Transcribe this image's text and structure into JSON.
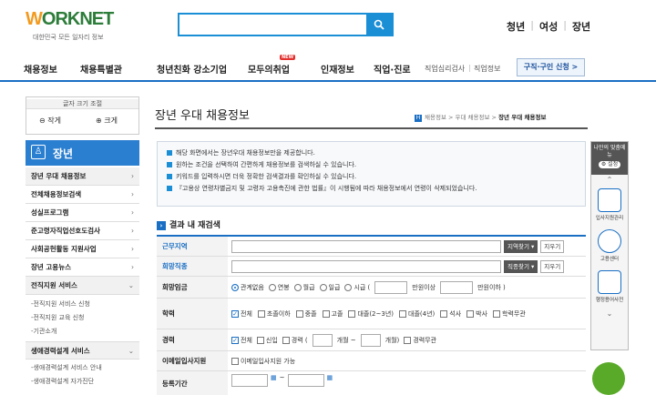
{
  "header": {
    "logo_text_w": "W",
    "logo_text_rest": "ORKNET",
    "logo_sub": "대한민국 모든 일자리 정보",
    "search_placeholder": "",
    "top_links": [
      "청년",
      "여성",
      "장년"
    ]
  },
  "nav": {
    "items": [
      "채용정보",
      "채용특별관",
      "청년친화 강소기업",
      "모두의취업",
      "인재정보",
      "직업·진로"
    ],
    "new_badge": "NEW",
    "small_links": [
      "직업심리검사",
      "직업정보"
    ],
    "recruit_button": "구직·구인 신청 >"
  },
  "sidebar": {
    "font_title": "글자 크기 조절",
    "font_small": "작게",
    "font_large": "크게",
    "section_title": "장년",
    "items": [
      {
        "label": "장년 우대 채용정보"
      },
      {
        "label": "전체채용정보검색"
      },
      {
        "label": "성실프로그램"
      },
      {
        "label": "준고령자직업선호도검사"
      },
      {
        "label": "사회공헌활동 지원사업"
      },
      {
        "label": "장년 고용뉴스"
      },
      {
        "label": "전직지원 서비스"
      }
    ],
    "sub_items_1": [
      "-전직지원 서비스 신청",
      "-전직지원 교육 신청",
      "-기관소개"
    ],
    "item_after": "생애경력설계 서비스",
    "sub_items_2": [
      "-생애경력설계 서비스 안내",
      "-생애경력설계 자가진단"
    ]
  },
  "main": {
    "page_title": "장년 우대 채용정보",
    "breadcrumb": [
      "채용정보",
      "우대 채용정보"
    ],
    "breadcrumb_current": "장년 우대 채용정보",
    "notices": [
      "해당 화면에서는 장년우대 채용정보만을 제공합니다.",
      "원하는 조건을 선택하여 간편하게 채용정보를 검색하실 수 있습니다.",
      "키워드를 입력하시면 더욱 정확한 검색결과를 확인하실 수 있습니다.",
      "『고용상 연령차별금지 및 고령자 고용촉진에 관한 법률』이 시행됨에 따라 채용정보에서 연령이 삭제되었습니다."
    ],
    "section_title": "결과 내 재검색",
    "form": {
      "region_label": "근무지역",
      "region_btn": "지역찾기",
      "reset": "지우기",
      "job_label": "희망직종",
      "job_btn": "직종찾기",
      "wage_label": "희망임금",
      "wage_options": [
        "관계없음",
        "연봉",
        "월급",
        "일급",
        "시급"
      ],
      "wage_min": "만원이상",
      "wage_max": "만원이하 )",
      "edu_label": "학력",
      "edu_options": [
        "전체",
        "초졸이하",
        "중졸",
        "고졸",
        "대졸(2~3년)",
        "대졸(4년)",
        "석사",
        "박사",
        "학력무관"
      ],
      "career_label": "경력",
      "career_options": [
        "전체",
        "신입",
        "경력"
      ],
      "career_month1": "개월 ~",
      "career_month2": "개월)",
      "career_any": "경력무관",
      "email_label": "이메일입사지원",
      "email_option": "이메일입사지원 가능",
      "date_label": "등록기간",
      "date_sep": "~"
    }
  },
  "rail": {
    "top": "나만의 맞춤메뉴",
    "setting": "설정",
    "items": [
      "입사지원관리",
      "고용센터",
      "행정용어사전"
    ]
  }
}
